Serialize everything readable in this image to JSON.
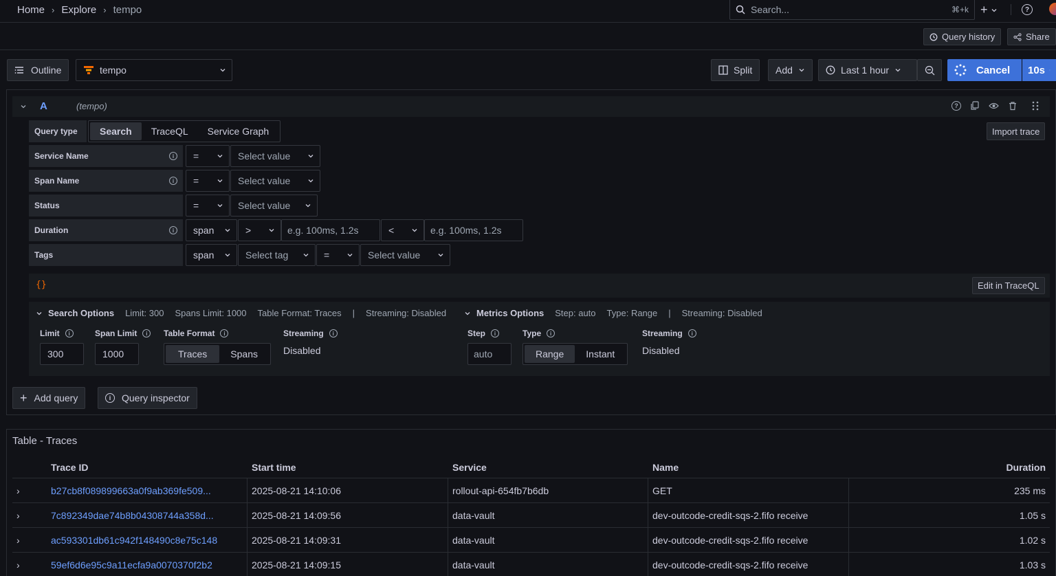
{
  "breadcrumb": {
    "items": [
      "Home",
      "Explore",
      "tempo"
    ]
  },
  "topbar": {
    "search_placeholder": "Search...",
    "shortcut": "⌘+k",
    "plus": "+"
  },
  "subbar": {
    "query_history": "Query history",
    "share": "Share"
  },
  "toolbar": {
    "outline": "Outline",
    "datasource": "tempo",
    "split": "Split",
    "add": "Add",
    "time_range": "Last 1 hour",
    "cancel": "Cancel",
    "refresh": "10s"
  },
  "query": {
    "ref_id": "A",
    "datasource_hint": "(tempo)",
    "query_type_label": "Query type",
    "query_types": [
      "Search",
      "TraceQL",
      "Service Graph"
    ],
    "import_trace": "Import trace",
    "rows": {
      "service_name": {
        "label": "Service Name",
        "op": "=",
        "value_placeholder": "Select value"
      },
      "span_name": {
        "label": "Span Name",
        "op": "=",
        "value_placeholder": "Select value"
      },
      "status": {
        "label": "Status",
        "op": "=",
        "value_placeholder": "Select value"
      },
      "duration": {
        "label": "Duration",
        "scope": "span",
        "op1": ">",
        "ph1": "e.g. 100ms, 1.2s",
        "op2": "<",
        "ph2": "e.g. 100ms, 1.2s"
      },
      "tags": {
        "label": "Tags",
        "scope": "span",
        "tag_placeholder": "Select tag",
        "op": "=",
        "value_placeholder": "Select value"
      }
    },
    "braces": "{}",
    "edit_traceql": "Edit in TraceQL"
  },
  "search_options": {
    "title": "Search Options",
    "summary": [
      "Limit: 300",
      "Spans Limit: 1000",
      "Table Format: Traces",
      "|",
      "Streaming: Disabled"
    ],
    "limit_label": "Limit",
    "limit_value": "300",
    "span_limit_label": "Span Limit",
    "span_limit_value": "1000",
    "table_format_label": "Table Format",
    "table_format_options": [
      "Traces",
      "Spans"
    ],
    "streaming_label": "Streaming",
    "streaming_value": "Disabled"
  },
  "metrics_options": {
    "title": "Metrics Options",
    "summary": [
      "Step: auto",
      "Type: Range",
      "|",
      "Streaming: Disabled"
    ],
    "step_label": "Step",
    "step_placeholder": "auto",
    "type_label": "Type",
    "type_options": [
      "Range",
      "Instant"
    ],
    "streaming_label": "Streaming",
    "streaming_value": "Disabled"
  },
  "actions": {
    "add_query": "Add query",
    "query_inspector": "Query inspector"
  },
  "table": {
    "title": "Table - Traces",
    "columns": [
      "Trace ID",
      "Start time",
      "Service",
      "Name",
      "Duration"
    ],
    "rows": [
      {
        "trace_id": "b27cb8f089899663a0f9ab369fe509...",
        "start": "2025-08-21 14:10:06",
        "service": "rollout-api-654fb7b6db",
        "name": "GET",
        "duration": "235 ms"
      },
      {
        "trace_id": "7c892349dae74b8b04308744a358d...",
        "start": "2025-08-21 14:09:56",
        "service": "data-vault",
        "name": "dev-outcode-credit-sqs-2.fifo receive",
        "duration": "1.05 s"
      },
      {
        "trace_id": "ac593301db61c942f148490c8e75c148",
        "start": "2025-08-21 14:09:31",
        "service": "data-vault",
        "name": "dev-outcode-credit-sqs-2.fifo receive",
        "duration": "1.02 s"
      },
      {
        "trace_id": "59ef6d6e95c9a11ecfa9a0070370f2b2",
        "start": "2025-08-21 14:09:15",
        "service": "data-vault",
        "name": "dev-outcode-credit-sqs-2.fifo receive",
        "duration": "1.03 s"
      }
    ]
  },
  "colors": {
    "background": "#111217",
    "panel": "#181b1f",
    "primary": "#3d71d9",
    "link": "#6e9fff",
    "tempo_orange": "#f46800"
  }
}
